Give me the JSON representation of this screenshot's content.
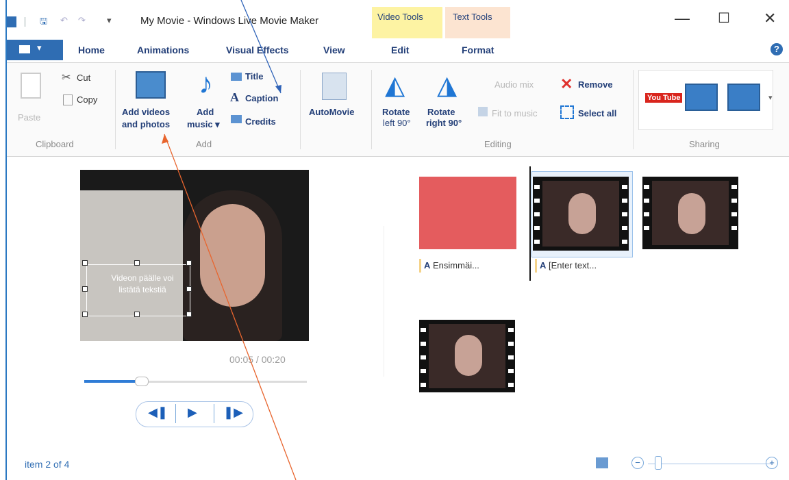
{
  "titlebar": {
    "title": "My Movie - Windows Live Movie Maker",
    "context_video": "Video Tools",
    "context_text": "Text Tools",
    "minimize": "—",
    "maximize": "☐",
    "close": "✕"
  },
  "tabs": {
    "home": "Home",
    "animations": "Animations",
    "visual_effects": "Visual Effects",
    "view": "View",
    "edit": "Edit",
    "format": "Format",
    "help": "?"
  },
  "ribbon": {
    "clipboard": {
      "label": "Clipboard",
      "paste": "Paste",
      "cut": "Cut",
      "copy": "Copy"
    },
    "add": {
      "label": "Add",
      "add_videos_l1": "Add videos",
      "add_videos_l2": "and photos",
      "add_music_l1": "Add",
      "add_music_l2": "music ▾",
      "title": "Title",
      "caption": "Caption",
      "credits": "Credits"
    },
    "automovie": {
      "label": "AutoMovie"
    },
    "editing": {
      "label": "Editing",
      "rotate_left_l1": "Rotate",
      "rotate_left_l2": "left 90°",
      "rotate_right_l1": "Rotate",
      "rotate_right_l2": "right 90°",
      "audio_mix": "Audio mix",
      "fit_to_music": "Fit to music",
      "remove": "Remove",
      "select_all": "Select all"
    },
    "sharing": {
      "label": "Sharing",
      "youtube": "You Tube"
    }
  },
  "preview": {
    "caption_l1": "Videon päälle voi",
    "caption_l2": "listätä tekstiä",
    "time": "00:05 / 00:20",
    "seek_progress": 0.25
  },
  "storyboard": {
    "clip1_caption": "Ensimmäi...",
    "clip2_caption": "[Enter text...",
    "caption_glyph": "A"
  },
  "status": {
    "item": "item 2 of 4",
    "zoom_out": "−",
    "zoom_in": "+"
  },
  "colors": {
    "accent": "#2f6db3",
    "title_clip": "#e45c5e",
    "video_tools": "#fdf3a3",
    "text_tools": "#fce4d1",
    "arrow_blue": "#2f63b8",
    "arrow_orange": "#e8652e"
  }
}
